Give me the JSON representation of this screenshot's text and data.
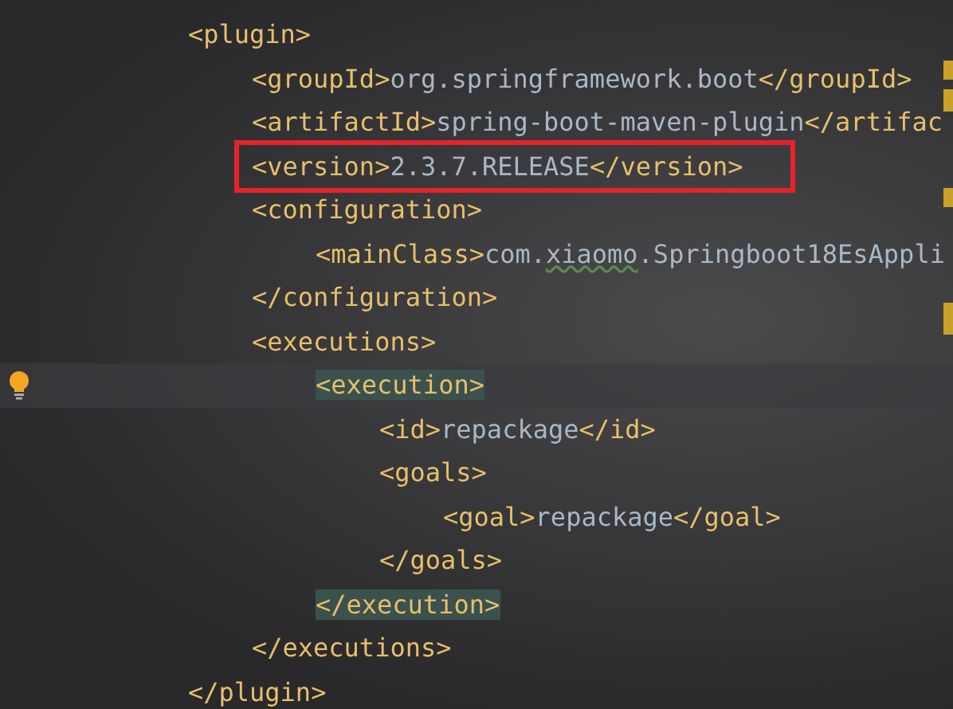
{
  "editor": {
    "lines": [
      {
        "current": false,
        "boxed": false,
        "bulb": false,
        "parts": [
          {
            "kind": "tag",
            "text": "<plugin>"
          }
        ],
        "children": [
          {
            "current": false,
            "boxed": false,
            "bulb": false,
            "parts": [
              {
                "kind": "tag",
                "text": "<groupId>"
              },
              {
                "kind": "value",
                "text": "org.springframework.boot"
              },
              {
                "kind": "tag",
                "text": "</groupId>"
              }
            ]
          },
          {
            "current": false,
            "boxed": false,
            "bulb": false,
            "parts": [
              {
                "kind": "tag",
                "text": "<artifactId>"
              },
              {
                "kind": "value",
                "text": "spring-boot-maven-plugin"
              },
              {
                "kind": "tag",
                "text": "</artifac"
              }
            ]
          },
          {
            "current": false,
            "boxed": true,
            "bulb": false,
            "parts": [
              {
                "kind": "tag",
                "text": "<version>"
              },
              {
                "kind": "value",
                "text": "2.3.7.RELEASE"
              },
              {
                "kind": "tag",
                "text": "</version>"
              }
            ]
          },
          {
            "current": false,
            "boxed": false,
            "bulb": false,
            "parts": [
              {
                "kind": "tag",
                "text": "<configuration>"
              }
            ],
            "children": [
              {
                "current": false,
                "boxed": false,
                "bulb": false,
                "parts": [
                  {
                    "kind": "tag",
                    "text": "<mainClass>"
                  },
                  {
                    "kind": "value",
                    "text": "com."
                  },
                  {
                    "kind": "typo",
                    "text": "xiaomo"
                  },
                  {
                    "kind": "value",
                    "text": ".Springboot18EsAppli"
                  }
                ]
              }
            ]
          },
          {
            "current": false,
            "boxed": false,
            "bulb": false,
            "parts": [
              {
                "kind": "tag",
                "text": "</configuration>"
              }
            ]
          },
          {
            "current": false,
            "boxed": false,
            "bulb": false,
            "parts": [
              {
                "kind": "tag",
                "text": "<executions>"
              }
            ],
            "children": [
              {
                "current": true,
                "boxed": false,
                "bulb": true,
                "parts": [
                  {
                    "kind": "matched_tag",
                    "text": "<execution>"
                  }
                ],
                "children": [
                  {
                    "current": false,
                    "boxed": false,
                    "bulb": false,
                    "parts": [
                      {
                        "kind": "tag",
                        "text": "<id>"
                      },
                      {
                        "kind": "value",
                        "text": "repackage"
                      },
                      {
                        "kind": "tag",
                        "text": "</id>"
                      }
                    ]
                  },
                  {
                    "current": false,
                    "boxed": false,
                    "bulb": false,
                    "parts": [
                      {
                        "kind": "tag",
                        "text": "<goals>"
                      }
                    ],
                    "children": [
                      {
                        "current": false,
                        "boxed": false,
                        "bulb": false,
                        "parts": [
                          {
                            "kind": "tag",
                            "text": "<goal>"
                          },
                          {
                            "kind": "value",
                            "text": "repackage"
                          },
                          {
                            "kind": "tag",
                            "text": "</goal>"
                          }
                        ]
                      }
                    ]
                  },
                  {
                    "current": false,
                    "boxed": false,
                    "bulb": false,
                    "parts": [
                      {
                        "kind": "tag",
                        "text": "</goals>"
                      }
                    ]
                  }
                ]
              },
              {
                "current": false,
                "boxed": false,
                "bulb": false,
                "parts": [
                  {
                    "kind": "matched_tag",
                    "text": "</execution>"
                  }
                ]
              }
            ]
          },
          {
            "current": false,
            "boxed": false,
            "bulb": false,
            "parts": [
              {
                "kind": "tag",
                "text": "</executions>"
              }
            ]
          }
        ]
      },
      {
        "current": false,
        "boxed": false,
        "bulb": false,
        "parts": [
          {
            "kind": "tag",
            "text": "</plugin>"
          }
        ]
      }
    ]
  }
}
